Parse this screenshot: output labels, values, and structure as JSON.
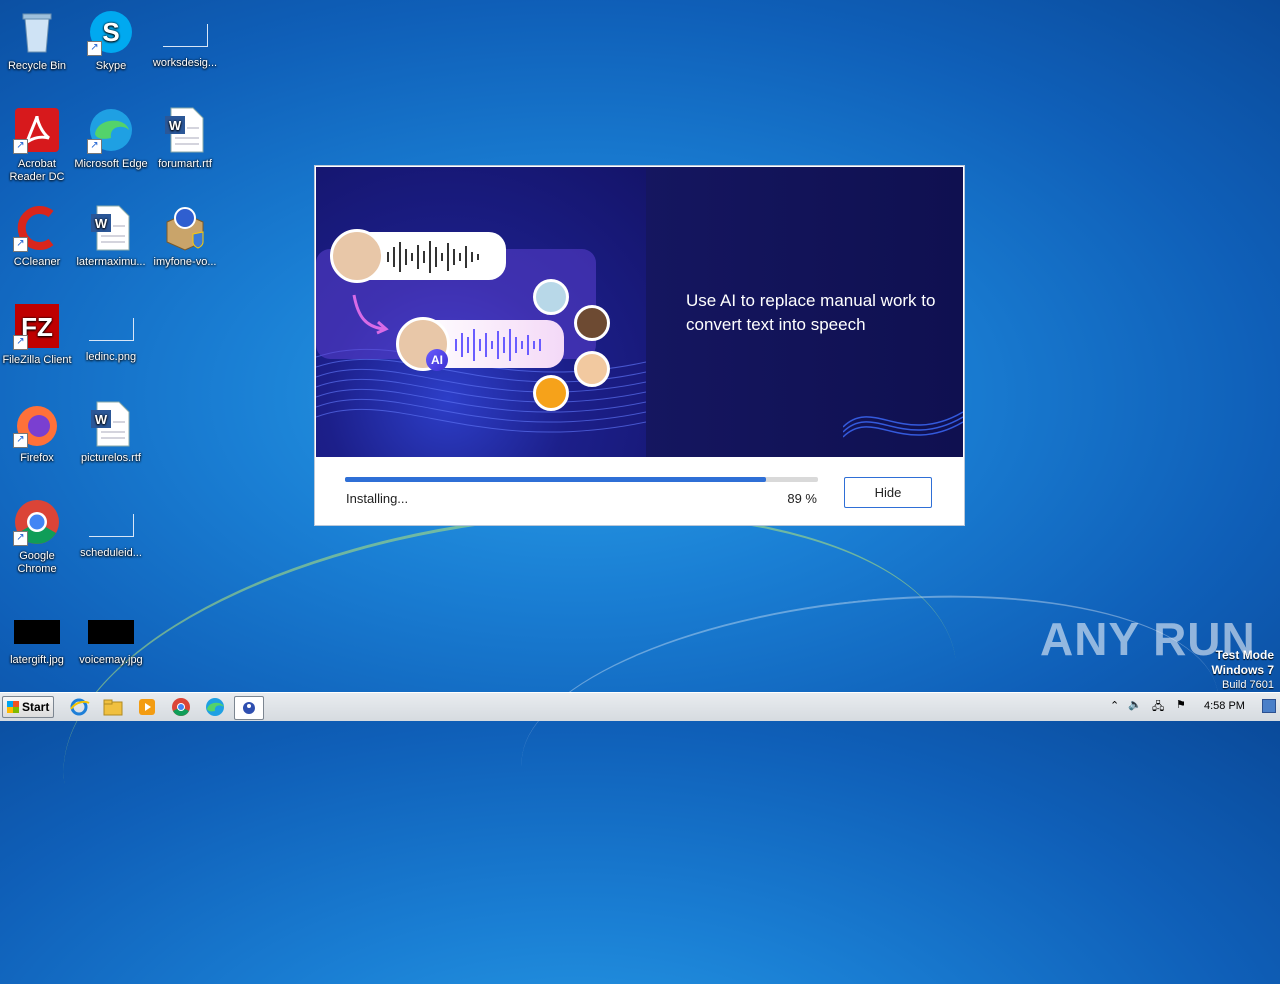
{
  "desktop": {
    "icons": [
      {
        "label": "Recycle Bin",
        "icon": "recycle-bin-icon"
      },
      {
        "label": "Skype",
        "icon": "skype-icon"
      },
      {
        "label": "worksdesig...",
        "icon": "image-file-icon"
      },
      {
        "label": "Acrobat Reader DC",
        "icon": "acrobat-icon"
      },
      {
        "label": "Microsoft Edge",
        "icon": "edge-icon"
      },
      {
        "label": "forumart.rtf",
        "icon": "word-document-icon"
      },
      {
        "label": "CCleaner",
        "icon": "ccleaner-icon"
      },
      {
        "label": "latermaximu...",
        "icon": "word-document-icon"
      },
      {
        "label": "imyfone-vo...",
        "icon": "installer-package-icon"
      },
      {
        "label": "FileZilla Client",
        "icon": "filezilla-icon"
      },
      {
        "label": "ledinc.png",
        "icon": "image-file-icon"
      },
      {
        "label": "Firefox",
        "icon": "firefox-icon"
      },
      {
        "label": "picturelos.rtf",
        "icon": "word-document-icon"
      },
      {
        "label": "Google Chrome",
        "icon": "chrome-icon"
      },
      {
        "label": "scheduleid...",
        "icon": "image-file-icon"
      },
      {
        "label": "latergift.jpg",
        "icon": "image-file-icon"
      },
      {
        "label": "voicemay.jpg",
        "icon": "image-file-icon"
      }
    ]
  },
  "installer": {
    "tagline": "Use AI to replace manual work to convert text into speech",
    "ai_badge": "AI",
    "status": "Installing...",
    "progress": 0.89,
    "progress_label": "89 %",
    "hide_label": "Hide"
  },
  "watermark": {
    "text": "ANY RUN"
  },
  "testmode": {
    "line1": "Test Mode",
    "line2": "Windows 7",
    "line3": "Build 7601"
  },
  "taskbar": {
    "start_label": "Start",
    "pinned": [
      "ie-icon",
      "explorer-icon",
      "media-player-icon",
      "chrome-icon",
      "edge-icon",
      "installer-icon"
    ],
    "clock": "4:58 PM"
  },
  "colors": {
    "accent": "#2f6fd6",
    "banner": "#15166a"
  }
}
